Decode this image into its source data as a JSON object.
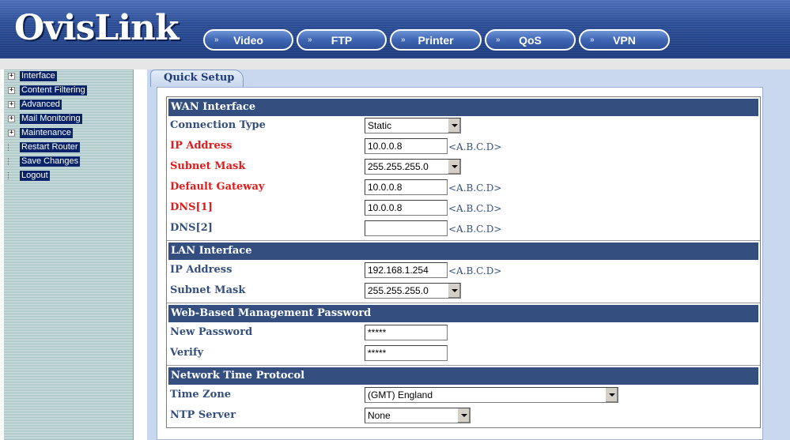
{
  "header": {
    "logo_text": "OvisLink",
    "nav": [
      {
        "label": "Video"
      },
      {
        "label": "FTP"
      },
      {
        "label": "Printer"
      },
      {
        "label": "QoS"
      },
      {
        "label": "VPN"
      }
    ],
    "nav_chevron": "»"
  },
  "sidebar": {
    "items": [
      {
        "label": "Interface",
        "expandable": true
      },
      {
        "label": "Content Filtering",
        "expandable": true
      },
      {
        "label": "Advanced",
        "expandable": true
      },
      {
        "label": "Mail Monitoring",
        "expandable": true
      },
      {
        "label": "Maintenance",
        "expandable": true
      },
      {
        "label": "Restart Router",
        "expandable": false
      },
      {
        "label": "Save Changes",
        "expandable": false
      },
      {
        "label": "Logout",
        "expandable": false
      }
    ],
    "plus_glyph": "+"
  },
  "tab": {
    "label": "Quick Setup"
  },
  "wan": {
    "title": "WAN Interface",
    "connection_type": {
      "label": "Connection Type",
      "value": "Static"
    },
    "ip_address": {
      "label": "IP Address",
      "value": "10.0.0.8",
      "hint": "<A.B.C.D>"
    },
    "subnet_mask": {
      "label": "Subnet Mask",
      "value": "255.255.255.0"
    },
    "default_gateway": {
      "label": "Default Gateway",
      "value": "10.0.0.8",
      "hint": "<A.B.C.D>"
    },
    "dns1": {
      "label": "DNS[1]",
      "value": "10.0.0.8",
      "hint": "<A.B.C.D>"
    },
    "dns2": {
      "label": "DNS[2]",
      "value": "",
      "hint": "<A.B.C.D>"
    }
  },
  "lan": {
    "title": "LAN Interface",
    "ip_address": {
      "label": "IP Address",
      "value": "192.168.1.254",
      "hint": "<A.B.C.D>"
    },
    "subnet_mask": {
      "label": "Subnet Mask",
      "value": "255.255.255.0"
    }
  },
  "password": {
    "title": "Web-Based Management Password",
    "new_password": {
      "label": "New Password",
      "value": "*****"
    },
    "verify": {
      "label": "Verify",
      "value": "*****"
    }
  },
  "ntp": {
    "title": "Network Time Protocol",
    "time_zone": {
      "label": "Time Zone",
      "value": "(GMT) England"
    },
    "ntp_server": {
      "label": "NTP Server",
      "value": "None"
    }
  },
  "colors": {
    "section_header": "#344f7f",
    "label": "#344f7f",
    "required_label": "#e21a1a",
    "sidebar_highlight": "#0a246a"
  }
}
